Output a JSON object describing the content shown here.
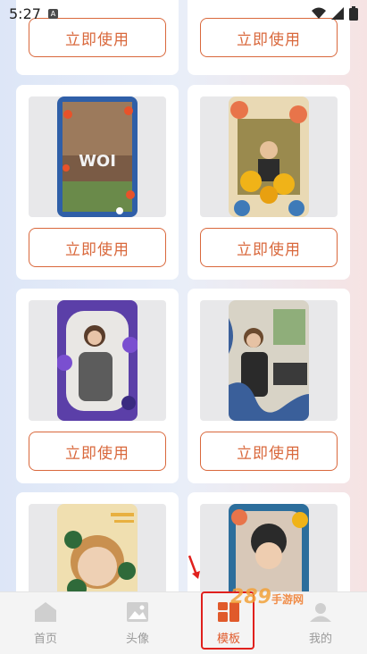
{
  "status_bar": {
    "time": "5:27"
  },
  "use_label": "立即使用",
  "tabs": [
    {
      "label": "首页",
      "icon": "home-icon"
    },
    {
      "label": "头像",
      "icon": "image-icon"
    },
    {
      "label": "模板",
      "icon": "template-icon",
      "active": true
    },
    {
      "label": "我的",
      "icon": "profile-icon"
    }
  ],
  "watermark": {
    "main": "289",
    "sub": "手游网"
  },
  "colors": {
    "accent": "#d9683c",
    "active_tab": "#e05a2b",
    "highlight": "#e0201d"
  }
}
